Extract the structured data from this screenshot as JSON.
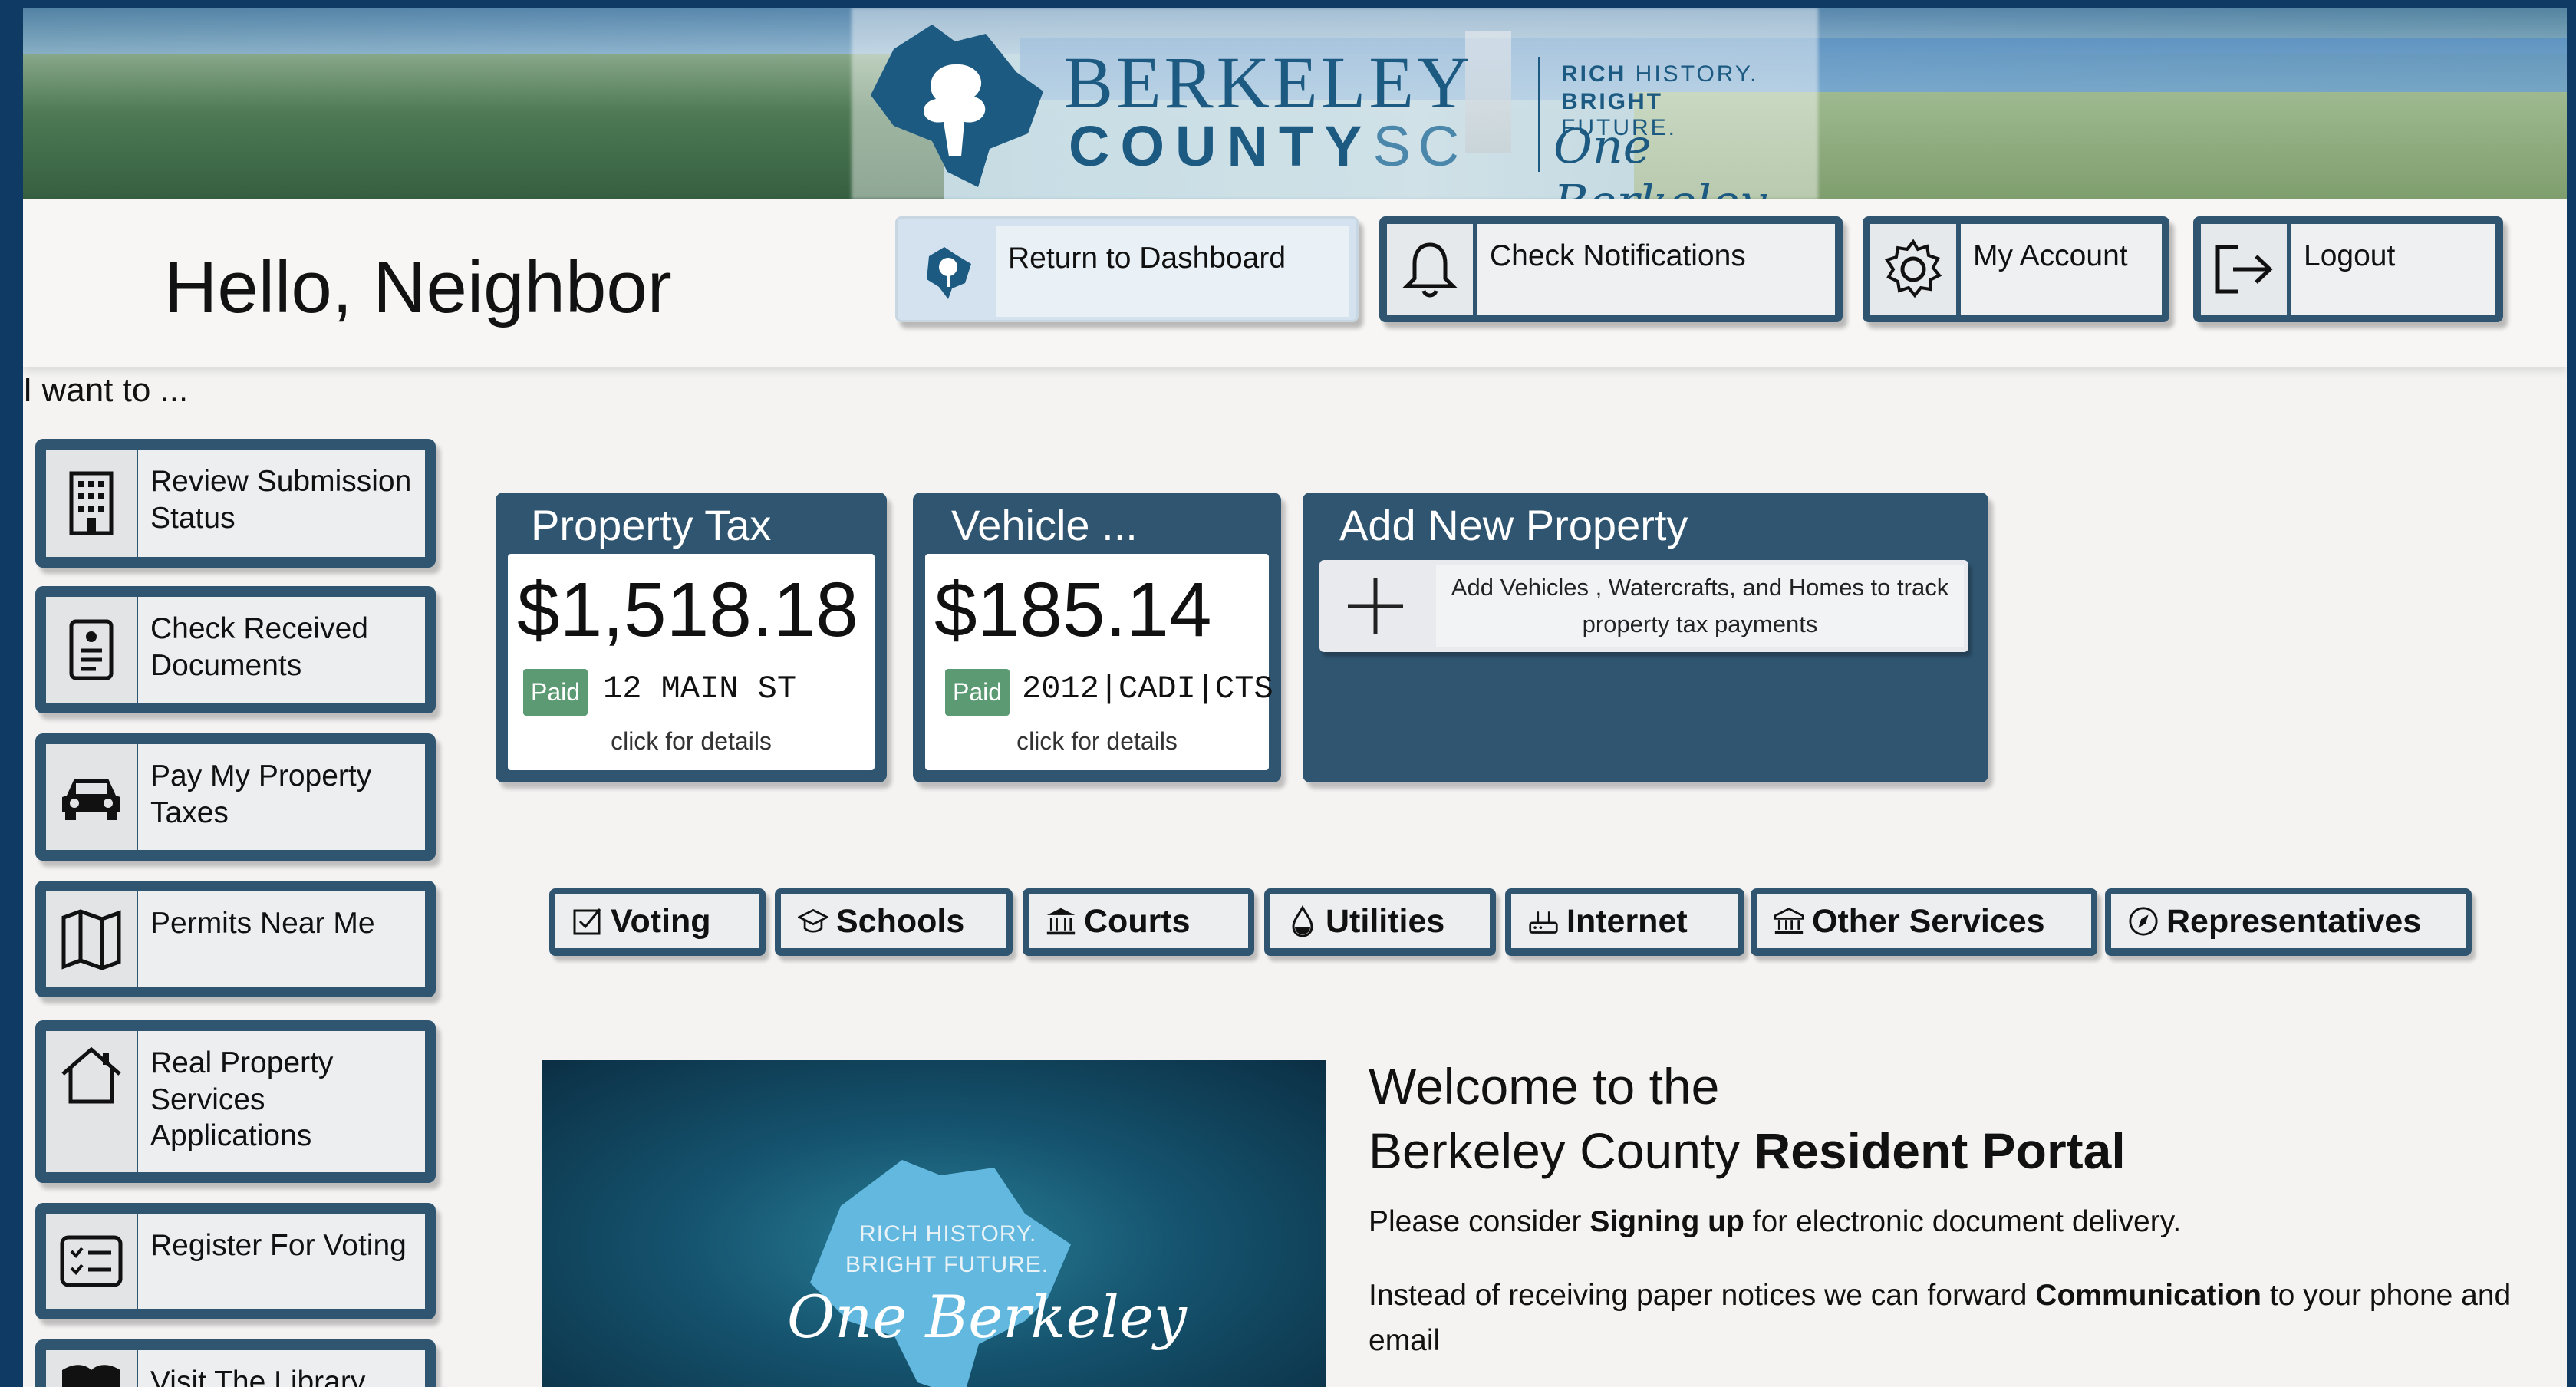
{
  "brand": {
    "name_line1": "BERKELEY",
    "name_line2": "COUNTY",
    "name_suffix": "SC",
    "tagline_1_bold": "RICH",
    "tagline_1_rest": " HISTORY.",
    "tagline_2_bold": "BRIGHT",
    "tagline_2_rest": " FUTURE.",
    "script": "One Berkeley"
  },
  "header": {
    "greeting": "Hello, Neighbor",
    "buttons": [
      {
        "label": "Return to Dashboard",
        "icon": "county-logo-icon"
      },
      {
        "label": "Check Notifications",
        "icon": "bell-icon"
      },
      {
        "label": "My Account",
        "icon": "gear-icon"
      },
      {
        "label": "Logout",
        "icon": "logout-icon"
      }
    ]
  },
  "sidebar": {
    "heading": "I want to ...",
    "items": [
      {
        "label": "Review Submission Status",
        "icon": "building-icon"
      },
      {
        "label": "Check Received Documents",
        "icon": "document-icon"
      },
      {
        "label": "Pay My Property Taxes",
        "icon": "car-icon"
      },
      {
        "label": "Permits Near Me",
        "icon": "map-icon"
      },
      {
        "label": "Real Property Services Applications",
        "icon": "house-icon"
      },
      {
        "label": "Register For Voting",
        "icon": "checklist-icon"
      },
      {
        "label": "Visit The Library",
        "icon": "book-icon"
      }
    ]
  },
  "cards": {
    "property_tax": {
      "title": "Property Tax",
      "amount": "$1,518.18",
      "status": "Paid",
      "address": "12 MAIN ST",
      "hint": "click for details"
    },
    "vehicle": {
      "title": "Vehicle ...",
      "amount": "$185.14",
      "status": "Paid",
      "address": "2012|CADI|CTS",
      "hint": "click for details"
    },
    "add_property": {
      "title": "Add New Property",
      "description": "Add Vehicles , Watercrafts, and Homes to track property tax payments"
    }
  },
  "services": [
    {
      "label": "Voting",
      "icon": "ballot-icon"
    },
    {
      "label": "Schools",
      "icon": "graduation-cap-icon"
    },
    {
      "label": "Courts",
      "icon": "courthouse-icon"
    },
    {
      "label": "Utilities",
      "icon": "water-drop-icon"
    },
    {
      "label": "Internet",
      "icon": "router-icon"
    },
    {
      "label": "Other Services",
      "icon": "bank-icon"
    },
    {
      "label": "Representatives",
      "icon": "compass-icon"
    }
  ],
  "welcome": {
    "line1": "Welcome to the",
    "line2_prefix": "Berkeley County ",
    "line2_bold": "Resident Portal",
    "para1_prefix": "Please consider ",
    "para1_bold": "Signing up",
    "para1_suffix": " for electronic document delivery.",
    "para2_prefix": "Instead of receiving paper notices we can forward ",
    "para2_bold": "Communication",
    "para2_suffix": " to your phone and email",
    "video": {
      "tag1": "RICH HISTORY.",
      "tag2": "BRIGHT FUTURE.",
      "script": "One Berkeley"
    }
  },
  "colors": {
    "navy_frame": "#0f3a63",
    "button_blue": "#2f5570",
    "paid_green": "#5b9a72",
    "brand_blue": "#1c5a82"
  }
}
